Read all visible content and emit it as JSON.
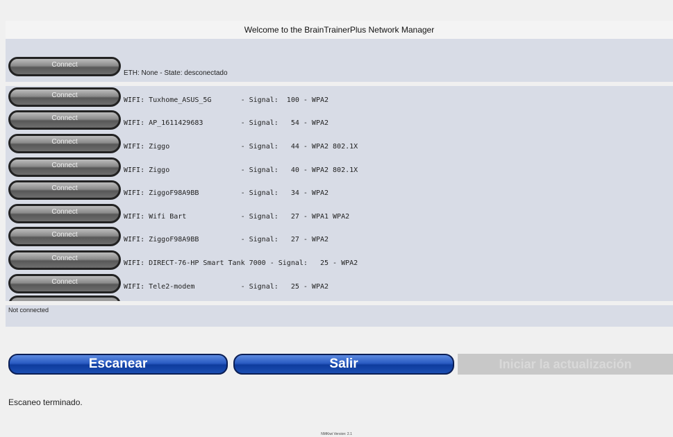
{
  "header": {
    "title": "Welcome to the BrainTrainerPlus Network Manager"
  },
  "eth": {
    "button_label": "Connect",
    "text": "ETH: None - State: desconectado"
  },
  "wifi": {
    "button_label": "Connect",
    "networks": [
      "WIFI: Tuxhome_ASUS_5G       - Signal:  100 - WPA2",
      "WIFI: AP_1611429683         - Signal:   54 - WPA2",
      "WIFI: Ziggo                 - Signal:   44 - WPA2 802.1X",
      "WIFI: Ziggo                 - Signal:   40 - WPA2 802.1X",
      "WIFI: ZiggoF98A9BB          - Signal:   34 - WPA2",
      "WIFI: Wifi Bart             - Signal:   27 - WPA1 WPA2",
      "WIFI: ZiggoF98A9BB          - Signal:   27 - WPA2",
      "WIFI: DIRECT-76-HP Smart Tank 7000 - Signal:   25 - WPA2",
      "WIFI: Tele2-modem           - Signal:   25 - WPA2"
    ]
  },
  "status": {
    "text": "Not connected"
  },
  "actions": {
    "scan_label": "Escanear",
    "exit_label": "Salir",
    "update_label": "Iniciar la actualización"
  },
  "messages": {
    "scan_done": "Escaneo terminado."
  },
  "footer": {
    "version": "NMKiwi Version: 2.1"
  }
}
